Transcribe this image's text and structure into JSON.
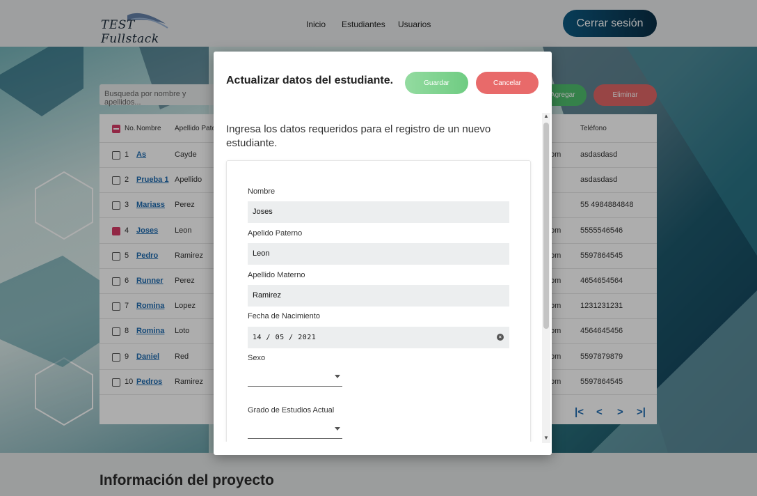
{
  "header": {
    "logo_text": "TEST Fullstack",
    "nav": [
      "Inicio",
      "Estudiantes",
      "Usuarios"
    ],
    "logout_label": "Cerrar sesión"
  },
  "toolbar": {
    "search_placeholder": "Busqueda por nombre y apellidos...",
    "add_label": "Agregar",
    "delete_label": "Eliminar"
  },
  "table": {
    "headers": {
      "no": "No.",
      "name": "Nombre",
      "apellido": "Apellido Paterno",
      "phone": "Teléfono"
    },
    "rows": [
      {
        "n": "1",
        "name": "As",
        "ap": "Cayde",
        "em": "om",
        "tel": "asdasdasd",
        "checked": false
      },
      {
        "n": "2",
        "name": "Prueba 1",
        "ap": "Apellido",
        "em": "",
        "tel": "asdasdasd",
        "checked": false
      },
      {
        "n": "3",
        "name": "Mariass",
        "ap": "Perez",
        "em": "",
        "tel": "55 4984884848",
        "checked": false
      },
      {
        "n": "4",
        "name": "Joses",
        "ap": "Leon",
        "em": "om",
        "tel": "5555546546",
        "checked": true
      },
      {
        "n": "5",
        "name": "Pedro",
        "ap": "Ramirez",
        "em": "om",
        "tel": "5597864545",
        "checked": false
      },
      {
        "n": "6",
        "name": "Runner",
        "ap": "Perez",
        "em": "om",
        "tel": "4654654564",
        "checked": false
      },
      {
        "n": "7",
        "name": "Romina",
        "ap": "Lopez",
        "em": "om",
        "tel": "1231231231",
        "checked": false
      },
      {
        "n": "8",
        "name": "Romina",
        "ap": "Loto",
        "em": "om",
        "tel": "4564645456",
        "checked": false
      },
      {
        "n": "9",
        "name": "Daniel",
        "ap": "Red",
        "em": "om",
        "tel": "5597879879",
        "checked": false
      },
      {
        "n": "10",
        "name": "Pedros",
        "ap": "Ramirez",
        "em": "om",
        "tel": "5597864545",
        "checked": false
      }
    ],
    "pager": [
      "|<",
      "<",
      ">",
      ">|"
    ]
  },
  "info": {
    "title": "Información del proyecto"
  },
  "modal": {
    "title": "Actualizar datos del estudiante.",
    "save_label": "Guardar",
    "cancel_label": "Cancelar",
    "subtitle": "Ingresa los datos requeridos para el registro de un nuevo estudiante.",
    "fields": {
      "nombre_label": "Nombre",
      "nombre_value": "Joses",
      "ap_paterno_label": "Apelido Paterno",
      "ap_paterno_value": "Leon",
      "ap_materno_label": "Apellido Materno",
      "ap_materno_value": "Ramirez",
      "fecha_label": "Fecha de Nacimiento",
      "fecha_value": "14 / 05 / 2021",
      "sexo_label": "Sexo",
      "grado_label": "Grado de Estudios Actual"
    }
  }
}
